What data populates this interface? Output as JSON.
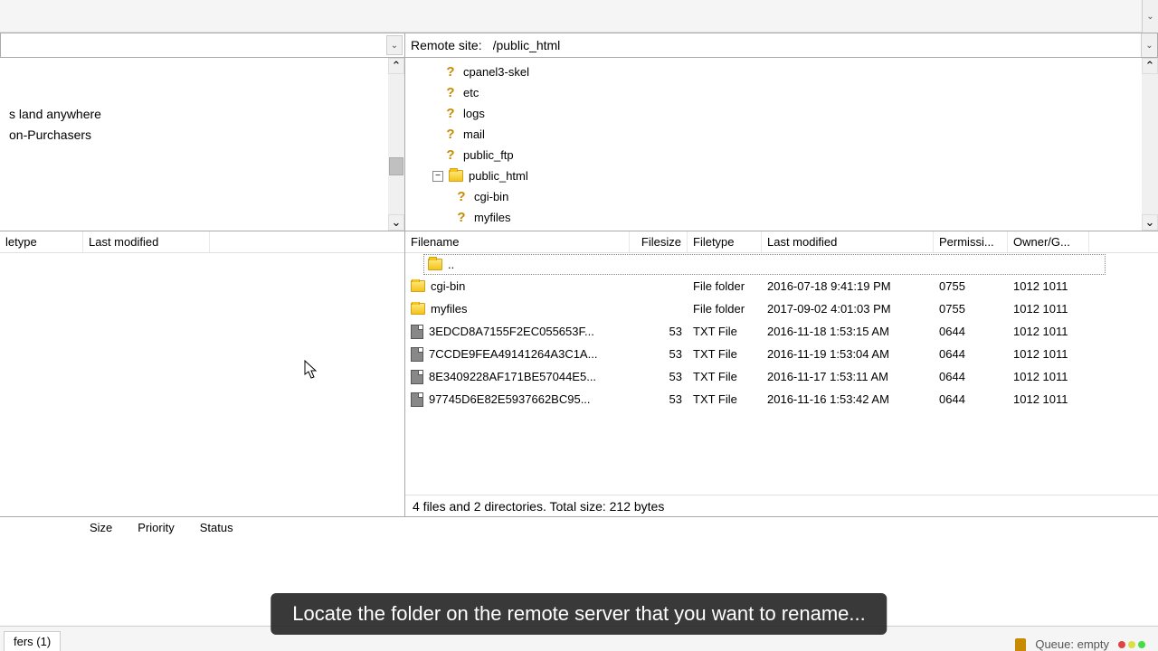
{
  "remote_site": {
    "label": "Remote site:",
    "path": "/public_html"
  },
  "local_tree_items": [
    {
      "label": "s land anywhere"
    },
    {
      "label": "on-Purchasers"
    }
  ],
  "remote_tree_items": [
    {
      "label": "cpanel3-skel",
      "icon": "question",
      "indent": 1
    },
    {
      "label": "etc",
      "icon": "question",
      "indent": 1
    },
    {
      "label": "logs",
      "icon": "question",
      "indent": 1
    },
    {
      "label": "mail",
      "icon": "question",
      "indent": 1
    },
    {
      "label": "public_ftp",
      "icon": "question",
      "indent": 1
    },
    {
      "label": "public_html",
      "icon": "folder",
      "indent": 1,
      "expanded": true
    },
    {
      "label": "cgi-bin",
      "icon": "question",
      "indent": 2
    },
    {
      "label": "myfiles",
      "icon": "question",
      "indent": 2
    }
  ],
  "local_columns": {
    "filetype": "letype",
    "last_modified": "Last modified"
  },
  "remote_columns": {
    "filename": "Filename",
    "filesize": "Filesize",
    "filetype": "Filetype",
    "last_modified": "Last modified",
    "permissions": "Permissi...",
    "owner": "Owner/G..."
  },
  "remote_files": [
    {
      "name": "..",
      "icon": "folder",
      "size": "",
      "type": "",
      "modified": "",
      "perm": "",
      "owner": "",
      "selected": true
    },
    {
      "name": "cgi-bin",
      "icon": "folder",
      "size": "",
      "type": "File folder",
      "modified": "2016-07-18 9:41:19 PM",
      "perm": "0755",
      "owner": "1012 1011"
    },
    {
      "name": "myfiles",
      "icon": "folder",
      "size": "",
      "type": "File folder",
      "modified": "2017-09-02 4:01:03 PM",
      "perm": "0755",
      "owner": "1012 1011"
    },
    {
      "name": "3EDCD8A7155F2EC055653F...",
      "icon": "file",
      "size": "53",
      "type": "TXT File",
      "modified": "2016-11-18 1:53:15 AM",
      "perm": "0644",
      "owner": "1012 1011"
    },
    {
      "name": "7CCDE9FEA49141264A3C1A...",
      "icon": "file",
      "size": "53",
      "type": "TXT File",
      "modified": "2016-11-19 1:53:04 AM",
      "perm": "0644",
      "owner": "1012 1011"
    },
    {
      "name": "8E3409228AF171BE57044E5...",
      "icon": "file",
      "size": "53",
      "type": "TXT File",
      "modified": "2016-11-17 1:53:11 AM",
      "perm": "0644",
      "owner": "1012 1011"
    },
    {
      "name": "97745D6E82E5937662BC95...",
      "icon": "file",
      "size": "53",
      "type": "TXT File",
      "modified": "2016-11-16 1:53:42 AM",
      "perm": "0644",
      "owner": "1012 1011"
    }
  ],
  "remote_status": "4 files and 2 directories. Total size: 212 bytes",
  "queue_columns": {
    "size": "Size",
    "priority": "Priority",
    "status": "Status"
  },
  "bottom_tab": "fers (1)",
  "queue_status": "Queue: empty",
  "caption": "Locate the folder on the remote server that you want to rename...",
  "expander_minus": "−"
}
